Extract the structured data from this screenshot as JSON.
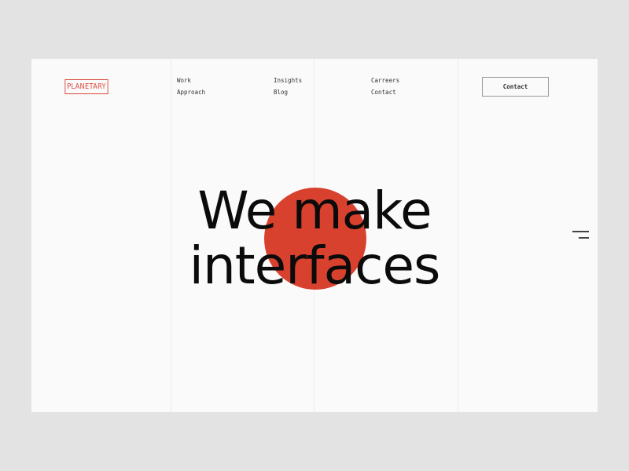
{
  "brand": {
    "logo": "PLANETARY",
    "accent_color": "#d9412f"
  },
  "nav": {
    "col1": [
      "Work",
      "Approach"
    ],
    "col2": [
      "Insights",
      "Blog"
    ],
    "col3": [
      "Carreers",
      "Contact"
    ]
  },
  "header": {
    "contact_button": "Contact"
  },
  "hero": {
    "line1": "We make",
    "line2": "interfaces"
  },
  "icons": {
    "menu": "menu-icon"
  }
}
